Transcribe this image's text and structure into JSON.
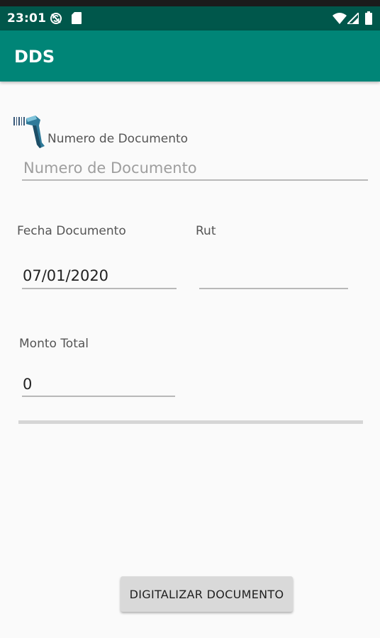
{
  "status_bar": {
    "time": "23:01",
    "left_icons": [
      "sync-off-icon",
      "sd-card-icon"
    ],
    "right_icons": [
      "wifi-icon",
      "cell-signal-icon",
      "battery-icon"
    ]
  },
  "app_bar": {
    "title": "DDS",
    "color": "#008577",
    "status_color": "#00574b"
  },
  "form": {
    "document_number": {
      "icon": "barcode-scanner-icon",
      "label": "Numero de Documento",
      "placeholder": "Numero de Documento",
      "value": ""
    },
    "document_date": {
      "label": "Fecha Documento",
      "value": "07/01/2020"
    },
    "rut": {
      "label": "Rut",
      "value": ""
    },
    "total_amount": {
      "label": "Monto Total",
      "value": "0"
    }
  },
  "actions": {
    "digitize_label": "DIGITALIZAR DOCUMENTO"
  }
}
